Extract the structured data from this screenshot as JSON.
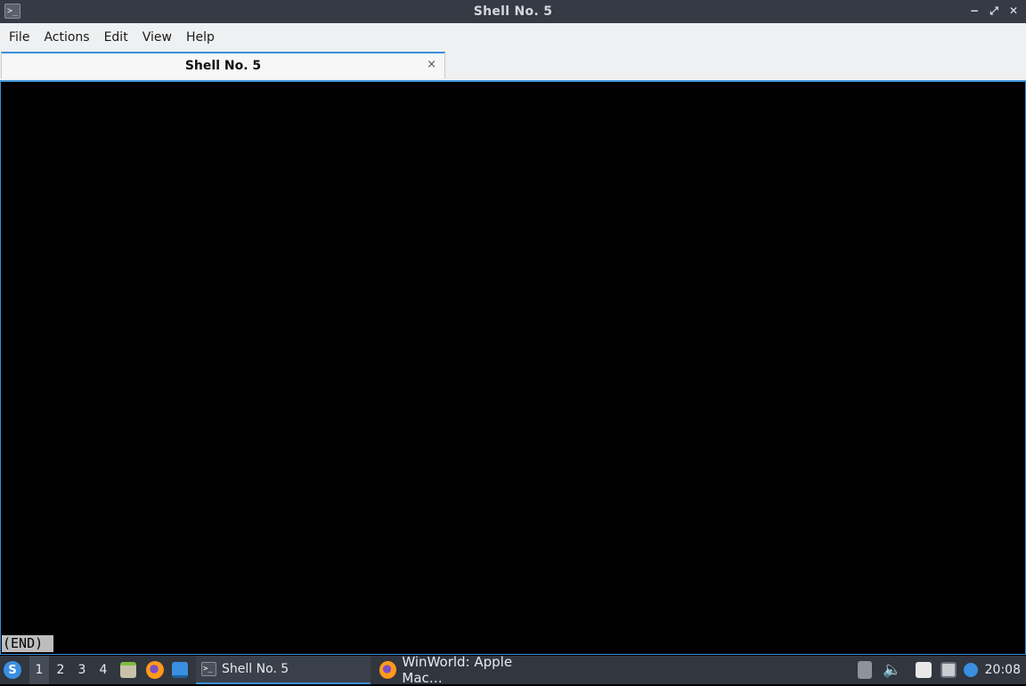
{
  "window": {
    "title": "Shell No. 5",
    "icon": "terminal-icon",
    "controls": {
      "minimize": "−",
      "maximize": "⤢",
      "close": "✕"
    }
  },
  "menubar": {
    "items": [
      {
        "label": "File"
      },
      {
        "label": "Actions"
      },
      {
        "label": "Edit"
      },
      {
        "label": "View"
      },
      {
        "label": "Help"
      }
    ]
  },
  "tabs": [
    {
      "label": "Shell No. 5",
      "close_glyph": "×",
      "active": true
    }
  ],
  "terminal": {
    "status_line": "(END)"
  },
  "taskbar": {
    "start_glyph": "S",
    "desktops": [
      "1",
      "2",
      "3",
      "4"
    ],
    "active_desktop": "1",
    "tasks": [
      {
        "label": "Shell No. 5",
        "icon": "terminal-icon",
        "active": true
      },
      {
        "label": "WinWorld: Apple Mac…",
        "icon": "firefox-icon",
        "active": false
      }
    ],
    "clock": "20:08",
    "colors": {
      "accent": "#3d8fd6",
      "panel": "#31363f"
    }
  }
}
